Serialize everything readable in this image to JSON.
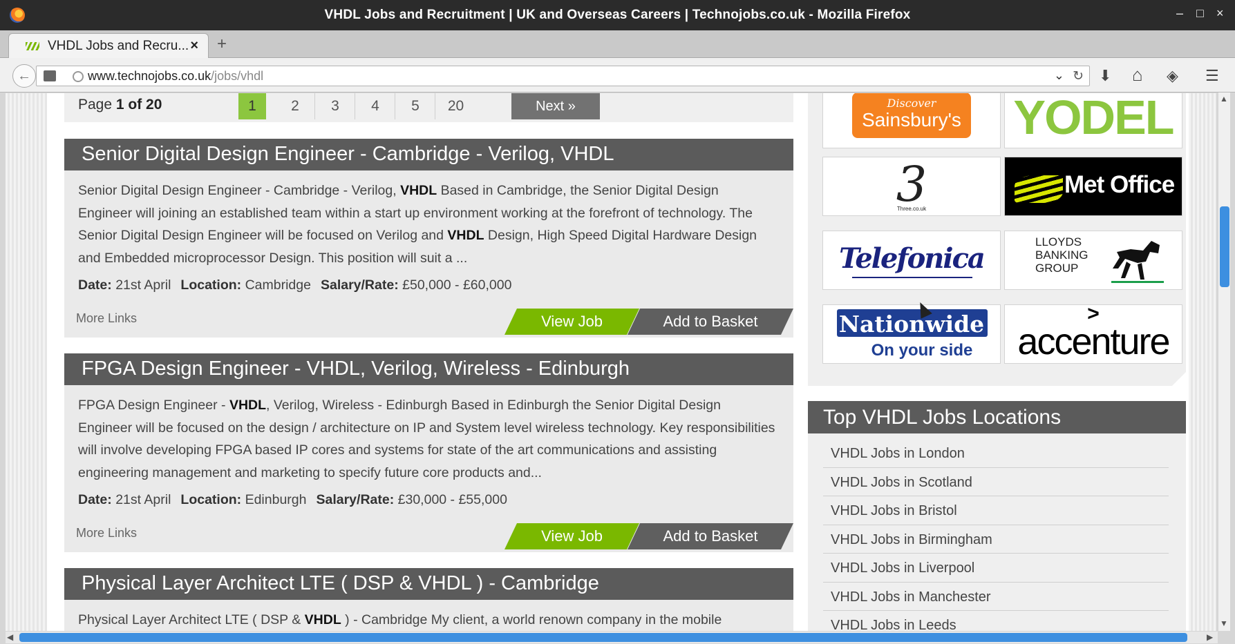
{
  "window": {
    "title": "VHDL Jobs and Recruitment | UK and Overseas Careers | Technojobs.co.uk - Mozilla Firefox",
    "controls": [
      "–",
      "□",
      "×"
    ]
  },
  "tab": {
    "label": "VHDL Jobs and Recru...",
    "close": "×",
    "newtab": "+"
  },
  "address": {
    "host": "www.technojobs.co.uk",
    "path": "/jobs/vhdl",
    "dropdown": "⌄",
    "reload": "↻"
  },
  "toolbar": {
    "download": "⬇",
    "home": "⌂",
    "pocket": "◈",
    "menu": "☰",
    "back": "←"
  },
  "pagination": {
    "prefix": "Page ",
    "current": "1 of 20",
    "pages": [
      "1",
      "2",
      "3",
      "4",
      "5",
      "20"
    ],
    "next": "Next »"
  },
  "jobs": [
    {
      "title": "Senior Digital Design Engineer - Cambridge - Verilog, VHDL",
      "desc": [
        "Senior Digital Design Engineer - Cambridge - Verilog, ",
        "VHDL",
        " Based in Cambridge, the Senior Digital Design Engineer will joining an established team within a start up environment working at the forefront of technology. The Senior Digital Design Engineer will be focused on Verilog and ",
        "VHDL",
        " Design, High Speed Digital Hardware Design and Embedded microprocessor Design. This position will suit a ..."
      ],
      "date_label": "Date:",
      "date": "21st April",
      "location_label": "Location:",
      "location": "Cambridge",
      "salary_label": "Salary/Rate:",
      "salary": "£50,000 - £60,000",
      "more": "More Links",
      "view": "View Job",
      "basket": "Add to Basket"
    },
    {
      "title": "FPGA Design Engineer - VHDL, Verilog, Wireless - Edinburgh",
      "desc": [
        "FPGA Design Engineer - ",
        "VHDL",
        ", Verilog, Wireless - Edinburgh Based in Edinburgh the Senior Digital Design Engineer will be focused on the design / architecture on IP and System level wireless technology. Key responsibilities will involve developing FPGA based IP cores and systems for state of the art communications and assisting engineering management and marketing to specify future core products and...",
        "",
        ""
      ],
      "date_label": "Date:",
      "date": "21st April",
      "location_label": "Location:",
      "location": "Edinburgh",
      "salary_label": "Salary/Rate:",
      "salary": "£30,000 - £55,000",
      "more": "More Links",
      "view": "View Job",
      "basket": "Add to Basket"
    },
    {
      "title": "Physical Layer Architect LTE ( DSP & VHDL ) - Cambridge",
      "desc": [
        "Physical Layer Architect LTE ( DSP & ",
        "VHDL",
        " ) - Cambridge My client, a world renown company in the mobile",
        "",
        ""
      ]
    }
  ],
  "logos": {
    "sainsburys_top": "Discover",
    "sainsburys": "Sainsbury's",
    "yodel": "YODEL",
    "three": "3",
    "three_sub": "Three.co.uk",
    "metoffice": "Met Office",
    "telefonica": "Telefonica",
    "lloyds_1": "LLOYDS",
    "lloyds_2": "BANKING",
    "lloyds_3": "GROUP",
    "nationwide": "Nationwide",
    "nationwide_sub": "On your side",
    "accenture": "accenture",
    "accenture_mark": ">"
  },
  "locations": {
    "title": "Top VHDL Jobs Locations",
    "items": [
      "VHDL Jobs in London",
      "VHDL Jobs in Scotland",
      "VHDL Jobs in Bristol",
      "VHDL Jobs in Birmingham",
      "VHDL Jobs in Liverpool",
      "VHDL Jobs in Manchester",
      "VHDL Jobs in Leeds"
    ]
  },
  "scroll": {
    "up": "▲",
    "down": "▼",
    "left": "◀",
    "right": "▶"
  }
}
